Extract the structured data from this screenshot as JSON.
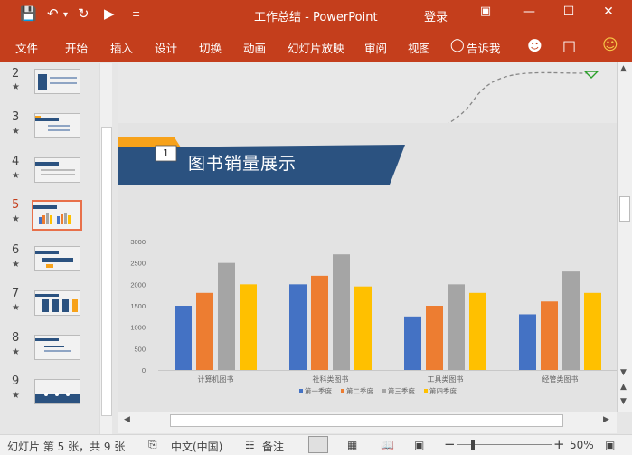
{
  "titlebar": {
    "title": "工作总结  -  PowerPoint",
    "login": "登录",
    "icons": [
      "save-icon",
      "undo-icon",
      "redo-icon",
      "start-from-beginning-icon",
      "customize-qat-icon",
      "ribbon-display-icon",
      "minimize-icon",
      "maximize-icon",
      "close-icon"
    ]
  },
  "menu": {
    "items": [
      "文件",
      "开始",
      "插入",
      "设计",
      "切换",
      "动画",
      "幻灯片放映",
      "审阅",
      "视图",
      "告诉我"
    ],
    "icons": [
      "lightbulb-icon",
      "share-user-icon",
      "comment-icon",
      "smiley-icon"
    ]
  },
  "thumbnails": [
    {
      "num": "2",
      "active": false
    },
    {
      "num": "3",
      "active": false
    },
    {
      "num": "4",
      "active": false
    },
    {
      "num": "5",
      "active": true
    },
    {
      "num": "6",
      "active": false
    },
    {
      "num": "7",
      "active": false
    },
    {
      "num": "8",
      "active": false
    },
    {
      "num": "9",
      "active": false
    }
  ],
  "slide": {
    "badge_number": "1",
    "title": "图书销量展示",
    "motion_path_marker": "motion-path-end-marker"
  },
  "chart_data": {
    "type": "bar",
    "categories": [
      "计算机图书",
      "社科类图书",
      "工具类图书",
      "经管类图书"
    ],
    "series": [
      {
        "name": "第一季度",
        "color": "#4472c4",
        "values": [
          1500,
          2000,
          1250,
          1300
        ]
      },
      {
        "name": "第二季度",
        "color": "#ed7d31",
        "values": [
          1800,
          2200,
          1500,
          1600
        ]
      },
      {
        "name": "第三季度",
        "color": "#a5a5a5",
        "values": [
          2500,
          2700,
          2000,
          2300
        ]
      },
      {
        "name": "第四季度",
        "color": "#ffc000",
        "values": [
          2000,
          1950,
          1800,
          1800
        ]
      }
    ],
    "ylim": [
      0,
      3000
    ],
    "yticks": [
      "0",
      "500",
      "1000",
      "1500",
      "2000",
      "2500",
      "3000"
    ],
    "legend_position": "bottom",
    "grid": false
  },
  "statusbar": {
    "slide_info": "幻灯片 第 5 张，共 9 张",
    "language": "中文(中国)",
    "notes": "备注",
    "zoom": "50%"
  }
}
